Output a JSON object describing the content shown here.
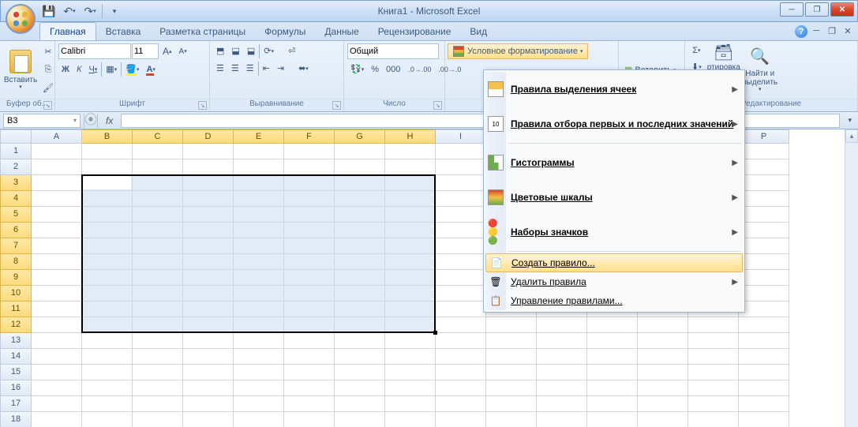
{
  "window": {
    "title": "Книга1 - Microsoft Excel"
  },
  "tabs": {
    "home": "Главная",
    "insert": "Вставка",
    "layout": "Разметка страницы",
    "formulas": "Формулы",
    "data": "Данные",
    "review": "Рецензирование",
    "view": "Вид"
  },
  "ribbon": {
    "clipboard": {
      "label": "Буфер об...",
      "paste": "Вставить"
    },
    "font": {
      "label": "Шрифт",
      "name": "Calibri",
      "size": "11",
      "bold": "Ж",
      "italic": "К",
      "underline": "Ч"
    },
    "alignment": {
      "label": "Выравнивание"
    },
    "number": {
      "label": "Число",
      "format": "Общий"
    },
    "styles_cond": "Условное форматирование",
    "cells": {
      "insert": "Вставить"
    },
    "editing": {
      "label": "Редактирование",
      "sigma": "Σ",
      "sort": "ртировка и фильтр",
      "find": "Найти и выделить"
    }
  },
  "formula": {
    "name_box": "B3",
    "fx": "fx"
  },
  "columns": [
    "A",
    "B",
    "C",
    "D",
    "E",
    "F",
    "G",
    "H",
    "I",
    "",
    "",
    "",
    "",
    "O",
    "P"
  ],
  "col_sel_start": 1,
  "col_sel_end": 7,
  "rows": [
    1,
    2,
    3,
    4,
    5,
    6,
    7,
    8,
    9,
    10,
    11,
    12,
    13,
    14,
    15,
    16,
    17,
    18
  ],
  "row_sel_start": 2,
  "row_sel_end": 11,
  "dropdown": {
    "highlight": "Правила выделения ячеек",
    "toprules": "Правила отбора первых и последних значений",
    "databars": "Гистограммы",
    "colorscales": "Цветовые шкалы",
    "iconsets": "Наборы значков",
    "newrule": "Создать правило...",
    "clear": "Удалить правила",
    "manage": "Управление правилами..."
  },
  "selection": {
    "active_cell": "B3",
    "range": "B3:H12"
  }
}
